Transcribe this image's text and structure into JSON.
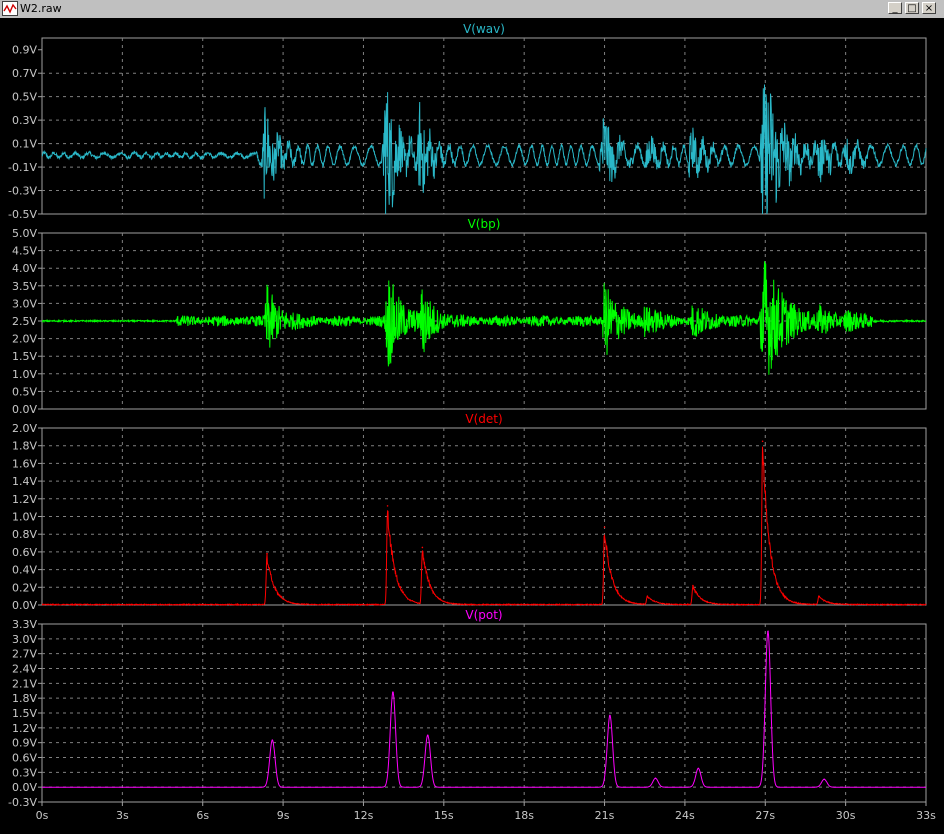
{
  "window": {
    "title": "W2.raw",
    "minimize_glyph": "_",
    "restore_glyph": "□",
    "close_glyph": "×",
    "icon": "waveform-icon"
  },
  "colors": {
    "plot_bg": "#000000",
    "label": "#c8c8c8",
    "grid": "#808080",
    "border": "#a0a0a0"
  },
  "x_axis": {
    "ticks": [
      0,
      3,
      6,
      9,
      12,
      15,
      18,
      21,
      24,
      27,
      30,
      33
    ],
    "tick_labels": [
      "0s",
      "3s",
      "6s",
      "9s",
      "12s",
      "15s",
      "18s",
      "21s",
      "24s",
      "27s",
      "30s",
      "33s"
    ],
    "range": [
      0,
      33
    ]
  },
  "chart_data": [
    {
      "type": "line",
      "title": "V(wav)",
      "color": "#2ab8c8",
      "kind": "wav",
      "ylim": [
        -0.5,
        1.0
      ],
      "yticks": [
        -0.5,
        -0.3,
        -0.1,
        0.1,
        0.3,
        0.5,
        0.7,
        0.9
      ],
      "ytick_labels": [
        "-0.5V",
        "-0.3V",
        "-0.1V",
        "0.1V",
        "0.3V",
        "0.5V",
        "0.7V",
        "0.9V"
      ],
      "bursts": [
        {
          "t": 8.3,
          "amp": 0.38,
          "dur": 0.45
        },
        {
          "t": 12.8,
          "amp": 0.65,
          "dur": 0.5
        },
        {
          "t": 14.1,
          "amp": 0.42,
          "dur": 0.4
        },
        {
          "t": 20.9,
          "amp": 0.35,
          "dur": 0.5
        },
        {
          "t": 22.6,
          "amp": 0.15,
          "dur": 0.4
        },
        {
          "t": 24.2,
          "amp": 0.2,
          "dur": 0.5
        },
        {
          "t": 26.9,
          "amp": 0.75,
          "dur": 0.7
        },
        {
          "t": 29.0,
          "amp": 0.2,
          "dur": 0.5
        },
        {
          "t": 30.0,
          "amp": 0.15,
          "dur": 0.4
        }
      ]
    },
    {
      "type": "line",
      "title": "V(bp)",
      "color": "#00ff00",
      "kind": "bp",
      "ylim": [
        0.0,
        5.0
      ],
      "yticks": [
        0.0,
        0.5,
        1.0,
        1.5,
        2.0,
        2.5,
        3.0,
        3.5,
        4.0,
        4.5,
        5.0
      ],
      "ytick_labels": [
        "0.0V",
        "0.5V",
        "1.0V",
        "1.5V",
        "2.0V",
        "2.5V",
        "3.0V",
        "3.5V",
        "4.0V",
        "4.5V",
        "5.0V"
      ],
      "baseline": 2.5,
      "bursts": [
        {
          "t": 8.4,
          "amp": 0.95,
          "dur": 0.45
        },
        {
          "t": 12.9,
          "amp": 1.4,
          "dur": 0.5
        },
        {
          "t": 14.2,
          "amp": 1.0,
          "dur": 0.4
        },
        {
          "t": 21.0,
          "amp": 1.1,
          "dur": 0.5
        },
        {
          "t": 22.5,
          "amp": 0.4,
          "dur": 0.5
        },
        {
          "t": 24.3,
          "amp": 0.45,
          "dur": 0.5
        },
        {
          "t": 26.9,
          "amp": 2.0,
          "dur": 0.7
        },
        {
          "t": 29.0,
          "amp": 0.35,
          "dur": 0.5
        },
        {
          "t": 30.0,
          "amp": 0.3,
          "dur": 0.4
        }
      ]
    },
    {
      "type": "line",
      "title": "V(det)",
      "color": "#ff0000",
      "kind": "det",
      "ylim": [
        0.0,
        2.0
      ],
      "yticks": [
        0.0,
        0.2,
        0.4,
        0.6,
        0.8,
        1.0,
        1.2,
        1.4,
        1.6,
        1.8,
        2.0
      ],
      "ytick_labels": [
        "0.0V",
        "0.2V",
        "0.4V",
        "0.6V",
        "0.8V",
        "1.0V",
        "1.2V",
        "1.4V",
        "1.6V",
        "1.8V",
        "2.0V"
      ],
      "peaks": [
        {
          "t": 8.4,
          "v": 0.58
        },
        {
          "t": 12.9,
          "v": 1.12
        },
        {
          "t": 14.2,
          "v": 0.65
        },
        {
          "t": 21.0,
          "v": 0.88
        },
        {
          "t": 22.6,
          "v": 0.1
        },
        {
          "t": 24.3,
          "v": 0.22
        },
        {
          "t": 26.9,
          "v": 1.85
        },
        {
          "t": 29.0,
          "v": 0.1
        }
      ]
    },
    {
      "type": "line",
      "title": "V(pot)",
      "color": "#ff00ff",
      "kind": "pot",
      "ylim": [
        -0.3,
        3.3
      ],
      "yticks": [
        -0.3,
        0.0,
        0.3,
        0.6,
        0.9,
        1.2,
        1.5,
        1.8,
        2.1,
        2.4,
        2.7,
        3.0,
        3.3
      ],
      "ytick_labels": [
        "-0.3V",
        "0.0V",
        "0.3V",
        "0.6V",
        "0.9V",
        "1.2V",
        "1.5V",
        "1.8V",
        "2.1V",
        "2.4V",
        "2.7V",
        "3.0V",
        "3.3V"
      ],
      "peaks": [
        {
          "t": 8.6,
          "v": 0.95
        },
        {
          "t": 13.1,
          "v": 1.92
        },
        {
          "t": 14.4,
          "v": 1.05
        },
        {
          "t": 21.2,
          "v": 1.45
        },
        {
          "t": 22.9,
          "v": 0.18
        },
        {
          "t": 24.5,
          "v": 0.38
        },
        {
          "t": 27.1,
          "v": 3.15
        },
        {
          "t": 29.2,
          "v": 0.16
        }
      ]
    }
  ]
}
